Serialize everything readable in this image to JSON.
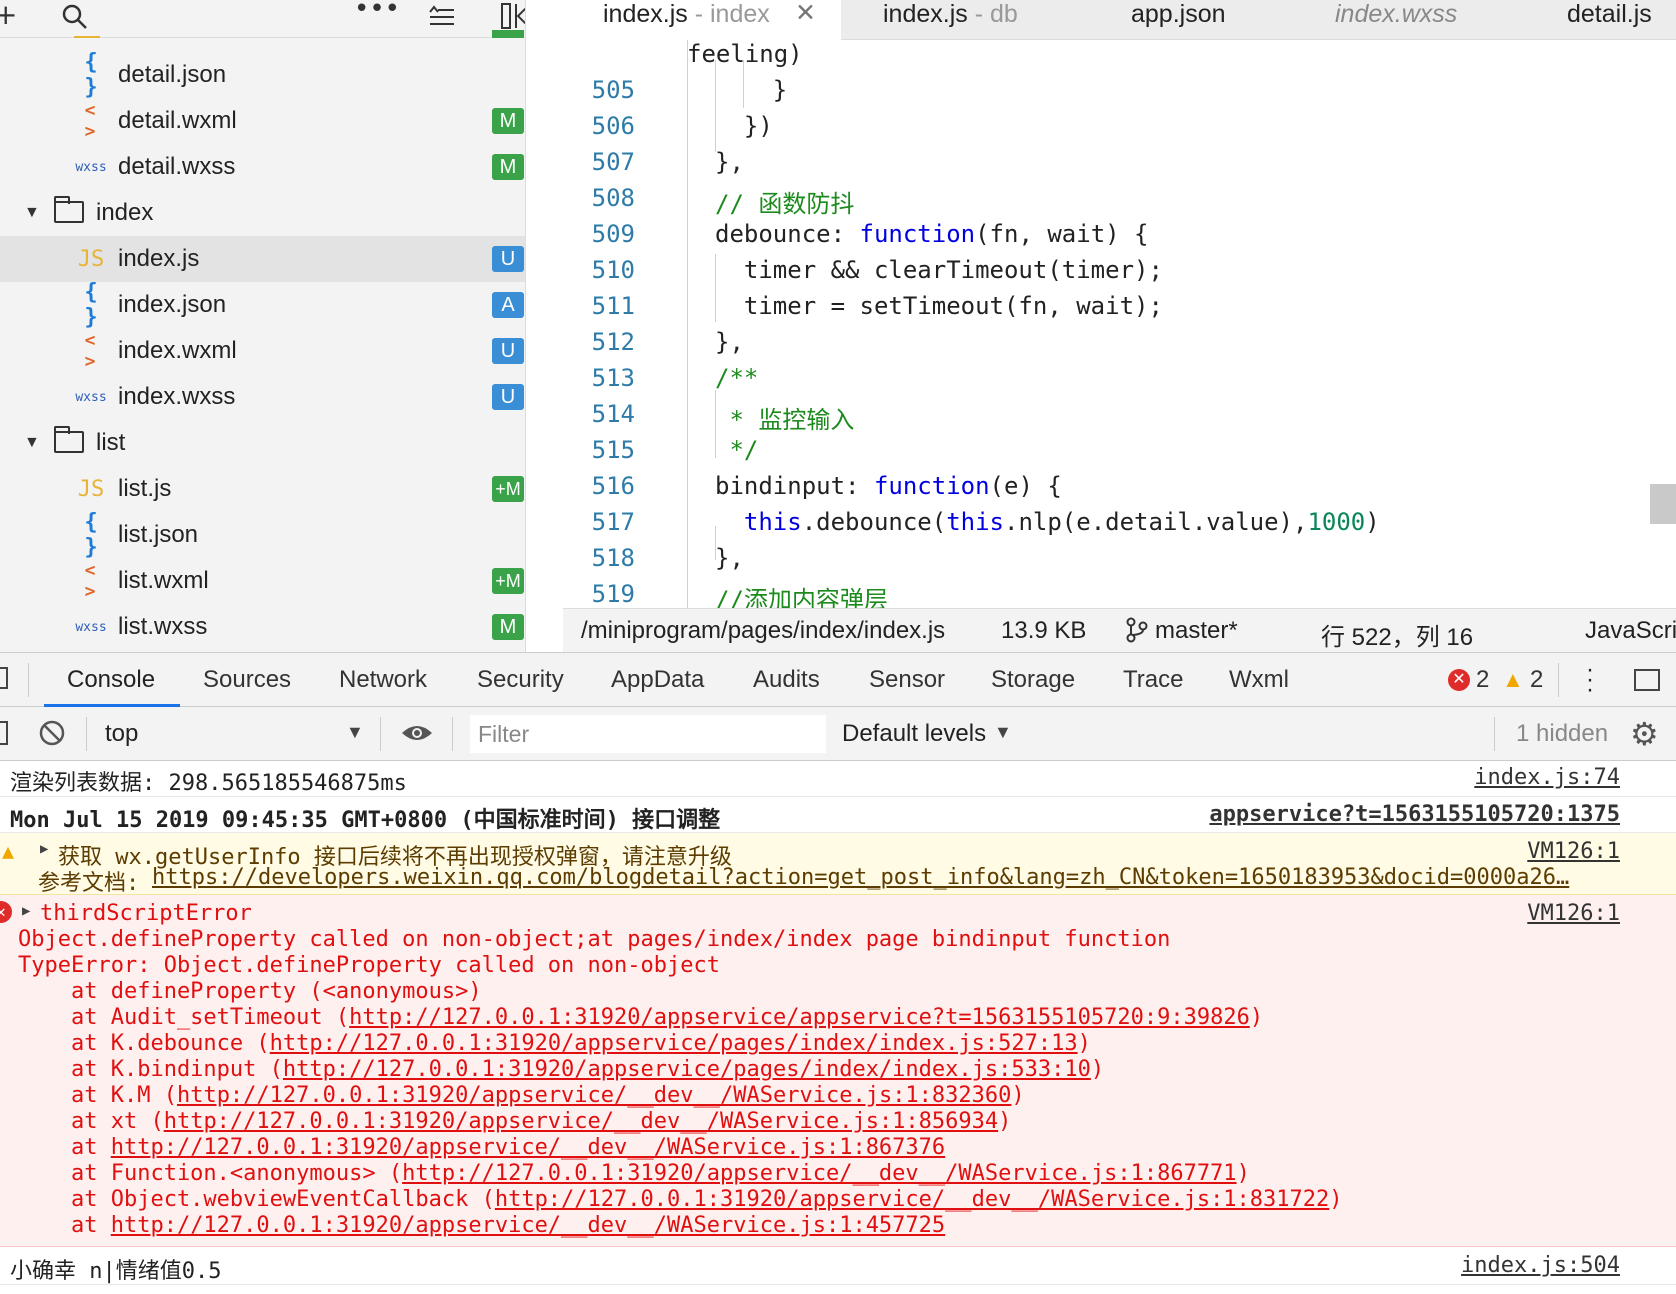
{
  "explorer": {
    "files": [
      {
        "icon": "{ }",
        "type": "json",
        "name": "detail.json",
        "badge": ""
      },
      {
        "icon": "< >",
        "type": "wxml",
        "name": "detail.wxml",
        "badge": "M"
      },
      {
        "icon": "wxss",
        "type": "wxss",
        "name": "detail.wxss",
        "badge": "M"
      }
    ],
    "folder_index": "index",
    "index_files": [
      {
        "icon": "JS",
        "type": "js",
        "name": "index.js",
        "badge": "U"
      },
      {
        "icon": "{ }",
        "type": "json",
        "name": "index.json",
        "badge": "A"
      },
      {
        "icon": "< >",
        "type": "wxml",
        "name": "index.wxml",
        "badge": "U"
      },
      {
        "icon": "wxss",
        "type": "wxss",
        "name": "index.wxss",
        "badge": "U"
      }
    ],
    "folder_list": "list",
    "list_files": [
      {
        "icon": "JS",
        "type": "js",
        "name": "list.js",
        "badge": "+M"
      },
      {
        "icon": "{ }",
        "type": "json",
        "name": "list.json",
        "badge": ""
      },
      {
        "icon": "< >",
        "type": "wxml",
        "name": "list.wxml",
        "badge": "+M"
      },
      {
        "icon": "wxss",
        "type": "wxss",
        "name": "list.wxss",
        "badge": "M"
      }
    ]
  },
  "tabs": [
    {
      "name": "index.js",
      "dir": " - index"
    },
    {
      "name": "index.js",
      "dir": " - db"
    },
    {
      "name": "app.json",
      "dir": ""
    },
    {
      "name": "index.wxss",
      "dir": ""
    },
    {
      "name": "detail.js",
      "dir": ""
    }
  ],
  "editor": {
    "top_line": "feeling)",
    "lines": [
      {
        "n": "505",
        "code": "    }"
      },
      {
        "n": "506",
        "code": "  })"
      },
      {
        "n": "507",
        "code": "},"
      },
      {
        "n": "508",
        "code": "// 函数防抖"
      },
      {
        "n": "509",
        "code": "debounce: function(fn, wait) {"
      },
      {
        "n": "510",
        "code": "  timer && clearTimeout(timer);"
      },
      {
        "n": "511",
        "code": "  timer = setTimeout(fn, wait);"
      },
      {
        "n": "512",
        "code": "},"
      },
      {
        "n": "513",
        "code": "/**"
      },
      {
        "n": "514",
        "code": " * 监控输入"
      },
      {
        "n": "515",
        "code": " */"
      },
      {
        "n": "516",
        "code": "bindinput: function(e) {"
      },
      {
        "n": "517",
        "code": "  this.debounce(this.nlp(e.detail.value),1000)"
      },
      {
        "n": "518",
        "code": "},"
      },
      {
        "n": "519",
        "code": "//添加内容弹层"
      }
    ]
  },
  "status": {
    "path": "/miniprogram/pages/index/index.js",
    "size": "13.9 KB",
    "branch": "master*",
    "position": "行 522，列 16",
    "language": "JavaScri"
  },
  "devtools": {
    "tabs": [
      "Console",
      "Sources",
      "Network",
      "Security",
      "AppData",
      "Audits",
      "Sensor",
      "Storage",
      "Trace",
      "Wxml"
    ],
    "error_count": "2",
    "warning_count": "2",
    "context": "top",
    "filter_placeholder": "Filter",
    "levels": "Default levels",
    "hidden": "1 hidden"
  },
  "console": {
    "m1_text": "渲染列表数据: 298.565185546875ms",
    "m1_src": "index.js:74",
    "m2_text": "Mon Jul 15 2019 09:45:35 GMT+0800 (中国标准时间) 接口调整",
    "m2_src": "appservice?t=1563155105720:1375",
    "warn_line1": "获取 wx.getUserInfo 接口后续将不再出现授权弹窗，请注意升级",
    "warn_prefix": "参考文档: ",
    "warn_link": "https://developers.weixin.qq.com/blogdetail?action=get_post_info&lang=zh_CN&token=1650183953&docid=0000a26…",
    "warn_src": "VM126:1",
    "err_title": "thirdScriptError",
    "err_src": "VM126:1",
    "err_line1": "Object.defineProperty called on non-object;at pages/index/index page bindinput function",
    "err_line2": "TypeError: Object.defineProperty called on non-object",
    "stack": [
      {
        "pre": "    at defineProperty (<anonymous>)",
        "url": "",
        "post": ""
      },
      {
        "pre": "    at Audit_setTimeout (",
        "url": "http://127.0.0.1:31920/appservice/appservice?t=1563155105720:9:39826",
        "post": ")"
      },
      {
        "pre": "    at K.debounce (",
        "url": "http://127.0.0.1:31920/appservice/pages/index/index.js:527:13",
        "post": ")"
      },
      {
        "pre": "    at K.bindinput (",
        "url": "http://127.0.0.1:31920/appservice/pages/index/index.js:533:10",
        "post": ")"
      },
      {
        "pre": "    at K.M (",
        "url": "http://127.0.0.1:31920/appservice/__dev__/WAService.js:1:832360",
        "post": ")"
      },
      {
        "pre": "    at xt (",
        "url": "http://127.0.0.1:31920/appservice/__dev__/WAService.js:1:856934",
        "post": ")"
      },
      {
        "pre": "    at ",
        "url": "http://127.0.0.1:31920/appservice/__dev__/WAService.js:1:867376",
        "post": ""
      },
      {
        "pre": "    at Function.<anonymous> (",
        "url": "http://127.0.0.1:31920/appservice/__dev__/WAService.js:1:867771",
        "post": ")"
      },
      {
        "pre": "    at Object.webviewEventCallback (",
        "url": "http://127.0.0.1:31920/appservice/__dev__/WAService.js:1:831722",
        "post": ")"
      },
      {
        "pre": "    at ",
        "url": "http://127.0.0.1:31920/appservice/__dev__/WAService.js:1:457725",
        "post": ""
      }
    ],
    "last_text": "小确幸 n|情绪值0.5",
    "last_src": "index.js:504"
  }
}
